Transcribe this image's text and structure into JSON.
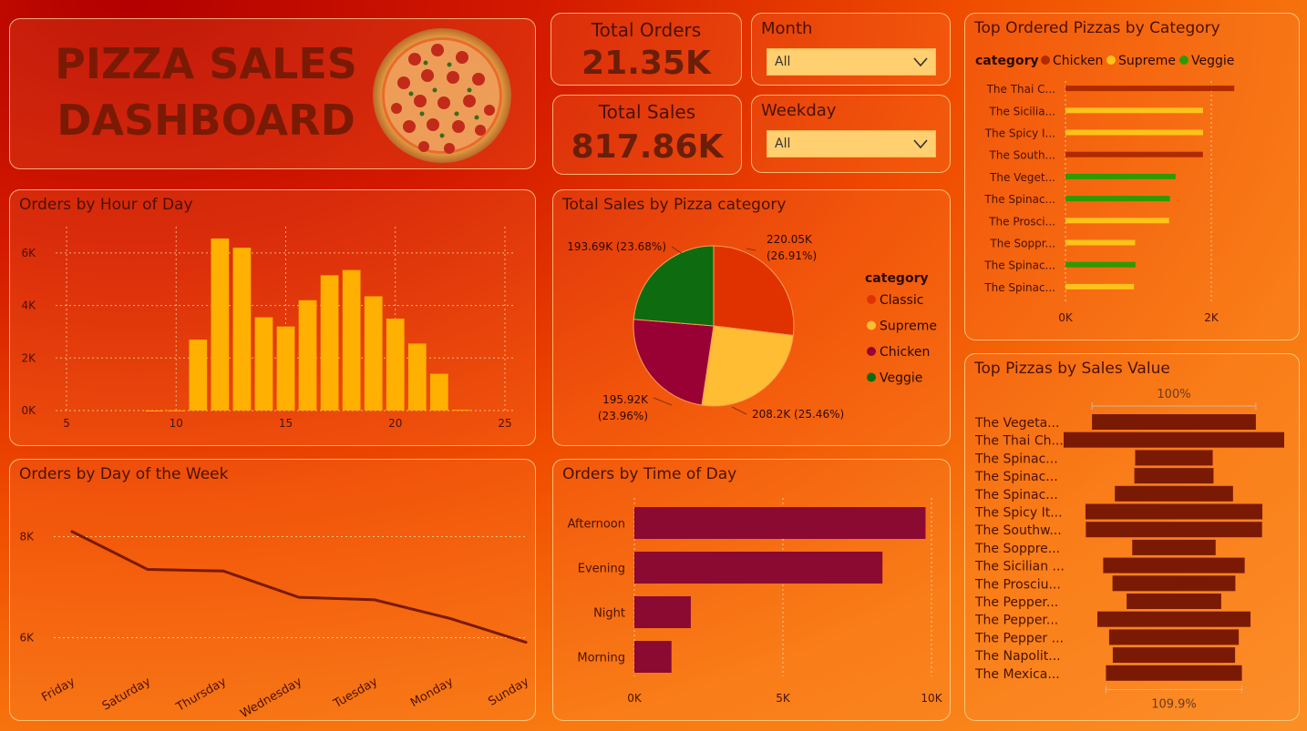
{
  "header": {
    "title_line1": "PIZZA SALES",
    "title_line2": "DASHBOARD"
  },
  "kpis": {
    "orders_label": "Total Orders",
    "orders_value": "21.35K",
    "sales_label": "Total Sales",
    "sales_value": "817.86K"
  },
  "filters": {
    "month_label": "Month",
    "month_value": "All",
    "weekday_label": "Weekday",
    "weekday_value": "All"
  },
  "colors": {
    "bar_yellow": "#ffb000",
    "line_dark": "#7a1a05",
    "time_bar": "#8b0a32",
    "chicken": "#b02a00",
    "supreme": "#ffc21a",
    "veggie": "#2e9a00",
    "classic": "#e03200",
    "pie_chicken": "#990033",
    "pie_veggie": "#0f6b0f",
    "pie_supreme": "#ffbd33",
    "top_bar": "#7a1a05"
  },
  "chart_data": [
    {
      "id": "hour",
      "type": "bar",
      "title": "Orders by Hour of Day",
      "x": [
        9,
        10,
        11,
        12,
        13,
        14,
        15,
        16,
        17,
        18,
        19,
        20,
        21,
        22,
        23
      ],
      "values": [
        2,
        8,
        2700,
        6550,
        6200,
        3550,
        3200,
        4200,
        5150,
        5350,
        4350,
        3500,
        2550,
        1400,
        30
      ],
      "xlim": [
        4.5,
        25.5
      ],
      "ylim": [
        0,
        7000
      ],
      "xticks": [
        "5",
        "10",
        "15",
        "20",
        "25"
      ],
      "yticks": [
        "0K",
        "2K",
        "4K",
        "6K"
      ]
    },
    {
      "id": "weekday",
      "type": "line",
      "title": "Orders by Day of the Week",
      "categories": [
        "Friday",
        "Saturday",
        "Thursday",
        "Wednesday",
        "Tuesday",
        "Monday",
        "Sunday"
      ],
      "values": [
        8100,
        7350,
        7320,
        6800,
        6750,
        6380,
        5910
      ],
      "ylim": [
        5200,
        8800
      ],
      "yticks": [
        "6K",
        "8K"
      ]
    },
    {
      "id": "category",
      "type": "pie",
      "title": "Total Sales by Pizza category",
      "legend_title": "category",
      "legend": [
        "Classic",
        "Supreme",
        "Chicken",
        "Veggie"
      ],
      "slices": [
        {
          "name": "Classic",
          "value": 220053.1,
          "label1": "220.05K",
          "label2": "(26.91%)"
        },
        {
          "name": "Supreme",
          "value": 208197.0,
          "label1": "208.2K (25.46%)",
          "label2": ""
        },
        {
          "name": "Chicken",
          "value": 195919.5,
          "label1": "195.92K",
          "label2": "(23.96%)"
        },
        {
          "name": "Veggie",
          "value": 193690.45,
          "label1": "193.69K (23.68%)",
          "label2": ""
        }
      ]
    },
    {
      "id": "timeofday",
      "type": "bar",
      "title": "Orders by Time of Day",
      "categories": [
        "Afternoon",
        "Evening",
        "Night",
        "Morning"
      ],
      "values": [
        9800,
        8350,
        1900,
        1250
      ],
      "xlim": [
        0,
        10000
      ],
      "xticks": [
        "0K",
        "5K",
        "10K"
      ]
    },
    {
      "id": "toporders",
      "type": "bar",
      "title": "Top Ordered Pizzas by Category",
      "legend_title": "category",
      "legend": [
        "Chicken",
        "Supreme",
        "Veggie"
      ],
      "categories": [
        "The Thai C...",
        "The Sicilia...",
        "The Spicy I...",
        "The South...",
        "The Veget...",
        "The Spinac...",
        "The Prosci...",
        "The Soppr...",
        "The Spinac...",
        "The Spinac..."
      ],
      "series_category": [
        "Chicken",
        "Supreme",
        "Supreme",
        "Chicken",
        "Veggie",
        "Veggie",
        "Supreme",
        "Supreme",
        "Veggie",
        "Supreme"
      ],
      "values": [
        2315,
        1887,
        1887,
        1885,
        1510,
        1432,
        1422,
        955,
        960,
        940
      ],
      "xlim": [
        0,
        2500
      ],
      "xticks": [
        "0K",
        "2K"
      ]
    },
    {
      "id": "topsales",
      "type": "bar",
      "title": "Top Pizzas by Sales Value",
      "top_label": "100%",
      "bottom_label": "109.9%",
      "categories": [
        "The Vegeta...",
        "The Thai Ch...",
        "The Spinac...",
        "The Spinac...",
        "The Spinac...",
        "The Spicy It...",
        "The Southw...",
        "The Soppre...",
        "The Sicilian ...",
        "The Prosciu...",
        "The Pepper...",
        "The Pepper...",
        "The Pepper ...",
        "The Napolit...",
        "The Mexica..."
      ],
      "values": [
        32266,
        43434,
        15278,
        15596,
        23271,
        34831,
        34706,
        16425,
        27866,
        24193,
        18618,
        30162,
        25529,
        24087,
        26780
      ]
    }
  ]
}
